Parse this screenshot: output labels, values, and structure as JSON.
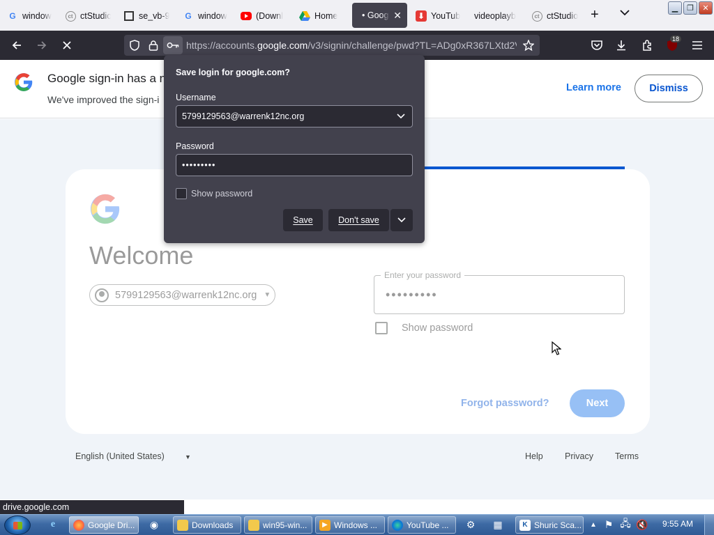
{
  "browser": {
    "tabs": [
      {
        "title": "window",
        "favicon": "google-g"
      },
      {
        "title": "ctStudio",
        "favicon": "circle-logo"
      },
      {
        "title": "se_vb-9",
        "favicon": "column-logo"
      },
      {
        "title": "window",
        "favicon": "google-g"
      },
      {
        "title": "(Downl",
        "favicon": "youtube-logo"
      },
      {
        "title": "Home",
        "favicon": "google-drive"
      },
      {
        "title": "• Goog",
        "favicon": "none",
        "active": true
      },
      {
        "title": "YouTub",
        "favicon": "downloader"
      },
      {
        "title": "videoplayb",
        "favicon": "none"
      },
      {
        "title": "ctStudio",
        "favicon": "circle-logo"
      }
    ],
    "close_tab_glyph": "✕",
    "new_tab_glyph": "+",
    "list_tabs_glyph": "⌄",
    "url_prefix": "https://accounts.",
    "url_domain": "google.com",
    "url_suffix": "/v3/signin/challenge/pwd?TL=ADg0xR367LXtd2V",
    "extension_badge": "18",
    "status_url": "drive.google.com"
  },
  "save_login_popup": {
    "title": "Save login for google.com?",
    "username_label": "Username",
    "username_value": "5799129563@warrenk12nc.org",
    "password_label": "Password",
    "password_value": "•••••••••",
    "show_password_label": "Show password",
    "save_label": "Save",
    "dont_save_label": "Don't save"
  },
  "google_banner": {
    "title": "Google sign-in has a n",
    "subtitle": "We've improved the sign-i",
    "learn_more": "Learn more",
    "dismiss": "Dismiss"
  },
  "signin": {
    "heading": "Welcome",
    "account_email": "5799129563@warrenk12nc.org",
    "password_field_label": "Enter your password",
    "password_value": "•••••••••",
    "show_password_label": "Show password",
    "forgot_password": "Forgot password?",
    "next_button": "Next",
    "progress_fraction": 1.0
  },
  "footer": {
    "language": "English (United States)",
    "links": [
      "Help",
      "Privacy",
      "Terms"
    ]
  },
  "taskbar": {
    "buttons": [
      {
        "label": "Google Dri...",
        "icon": "firefox-icon",
        "active": true
      },
      {
        "label": "Downloads",
        "icon": "folder-icon"
      },
      {
        "label": "win95-win...",
        "icon": "folder-icon"
      },
      {
        "label": "Windows ...",
        "icon": "media-player-icon"
      },
      {
        "label": "YouTube ...",
        "icon": "edge-icon"
      },
      {
        "label": "Shuric Sca...",
        "icon": "scanner-icon"
      }
    ],
    "clock": "9:55 AM"
  },
  "colors": {
    "firefox_toolbar": "#2b2a33",
    "popup_bg": "#42414d",
    "google_blue": "#1a73e8",
    "page_bg": "#f0f4f9",
    "taskbar": "#3d6aa4"
  }
}
